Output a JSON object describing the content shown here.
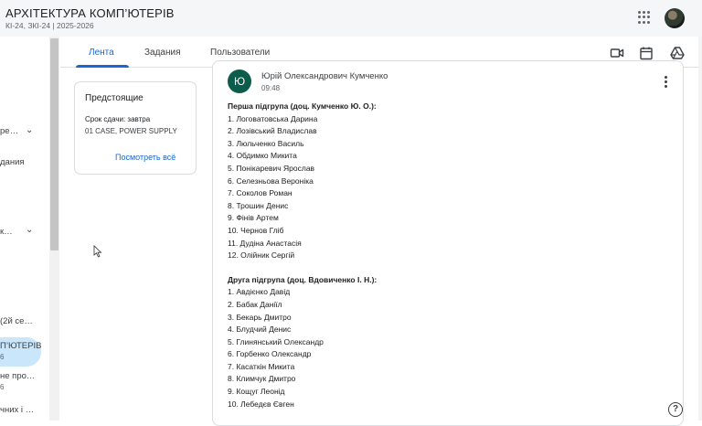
{
  "header": {
    "title": "АРХІТЕКТУРА КОМП’ЮТЕРІВ",
    "subtitle": "КІ-24, ЗКІ-24 | 2025-2026",
    "apps_icon": "apps-grid-icon",
    "account_icon": "avatar"
  },
  "sidebar": {
    "items": [
      {
        "label": "ре…",
        "sub": ""
      },
      {
        "label": "дания",
        "sub": ""
      },
      {
        "label": "к…",
        "sub": ""
      },
      {
        "label": "(2й се…",
        "sub": ""
      },
      {
        "label": "П’ЮТЕРІВ",
        "sub": "6"
      },
      {
        "label": "не про…",
        "sub": "6"
      },
      {
        "label": "чних і …",
        "sub": ""
      }
    ]
  },
  "tabs": [
    {
      "label": "Лента",
      "active": true
    },
    {
      "label": "Задания",
      "active": false
    },
    {
      "label": "Пользователи",
      "active": false
    }
  ],
  "toolbar_icons": [
    "video-icon",
    "calendar-icon",
    "drive-icon"
  ],
  "upcoming": {
    "title": "Предстоящие",
    "due": "Срок сдачи: завтра",
    "task": "01 CASE, POWER SUPPLY",
    "link": "Посмотреть всё"
  },
  "post": {
    "avatar_letter": "Ю",
    "avatar_color": "#0b5c4a",
    "author": "Юрій Олександрович Кумченко",
    "time": "09:48",
    "group1": {
      "title": "Перша підгрупа (доц. Кумченко Ю. О.):",
      "members": [
        "1. Логоватовська Дарина",
        "2. Лозівський Владислав",
        "3. Люльченко Василь",
        "4. Обдимко Микита",
        "5. Понікаревич Ярослав",
        "6. Селезньова Вероніка",
        "7. Соколов Роман",
        "8. Трошин Денис",
        "9. Фінів Артем",
        "10. Чернов Гліб",
        "11. Дудіна Анастасія",
        "12. Олійник Сергій"
      ]
    },
    "group2": {
      "title": "Друга підгрупа (доц. Вдовиченко І. Н.):",
      "members": [
        "1. Авдієнко Давід",
        "2. Бабак Даніїл",
        "3. Бекарь Дмитро",
        "4. Блудчий Денис",
        "5. Глинянський Олександр",
        "6. Горбенко Олександр",
        "7. Касаткін Микита",
        "8. Климчук Дмитро",
        "9. Кощуг Леонід",
        "10. Лебедєв Євген"
      ]
    }
  },
  "help_label": "?",
  "colors": {
    "accent": "#1967d2",
    "active_nav": "#c9e6fb"
  }
}
